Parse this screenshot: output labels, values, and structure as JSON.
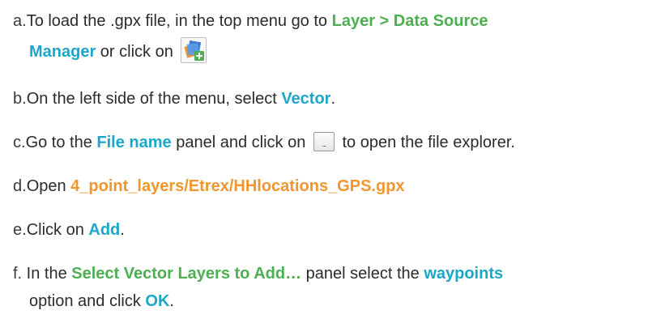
{
  "steps": {
    "a": {
      "letter": "a.",
      "text1": "To load the .gpx file, in the top menu go to ",
      "menu_path": "Layer > Data Source",
      "menu_path_2": "Manager",
      "text2": " or click on ",
      "icon": "data-source-manager-icon"
    },
    "b": {
      "letter": "b.",
      "text1": "On the left side of the menu, select ",
      "highlight": "Vector",
      "text2": "."
    },
    "c": {
      "letter": "c.",
      "text1": "Go to the ",
      "highlight": "File name",
      "text2": " panel and click on ",
      "button_label": "...",
      "text3": " to open the file explorer."
    },
    "d": {
      "letter": "d.",
      "text1": "Open ",
      "highlight": "4_point_layers/Etrex/HHlocations_GPS.gpx"
    },
    "e": {
      "letter": "e.",
      "text1": "Click on ",
      "highlight": "Add",
      "text2": "."
    },
    "f": {
      "letter": "f.",
      "text1": " In the ",
      "highlight1": "Select Vector Layers to Add…",
      "text2": " panel select the ",
      "highlight2": "waypoints",
      "text3": "option and click ",
      "highlight3": "OK",
      "text4": "."
    }
  },
  "colors": {
    "green": "#4caf50",
    "cyan": "#1aa7c9",
    "orange": "#f0962e"
  }
}
